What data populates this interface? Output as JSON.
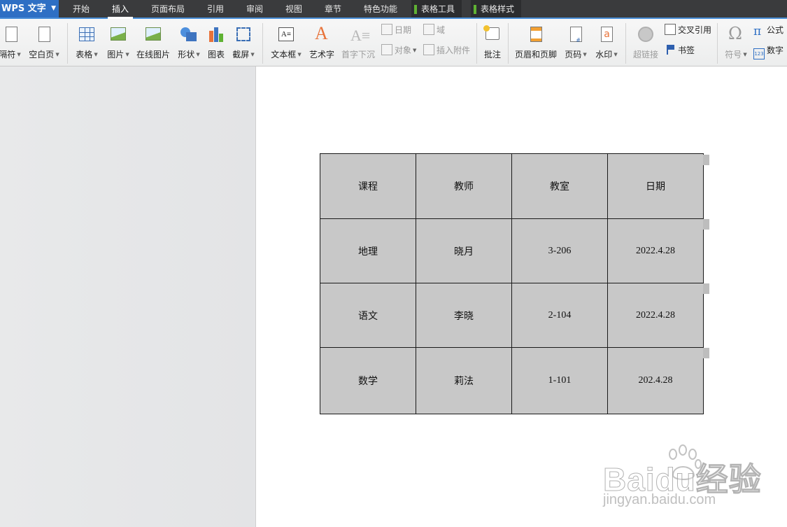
{
  "app": {
    "title": "WPS 文字"
  },
  "menu": {
    "tabs": [
      "开始",
      "插入",
      "页面布局",
      "引用",
      "审阅",
      "视图",
      "章节",
      "特色功能"
    ],
    "active": "插入",
    "context_tabs": [
      "表格工具",
      "表格样式"
    ]
  },
  "ribbon": {
    "break": "隔符",
    "blank_page": "空白页",
    "table": "表格",
    "picture": "图片",
    "online_picture": "在线图片",
    "shapes": "形状",
    "chart": "图表",
    "screenshot": "截屏",
    "text_box": "文本框",
    "word_art": "艺术字",
    "drop_cap": "首字下沉",
    "date": "日期",
    "field": "域",
    "object": "对象",
    "attachment": "插入附件",
    "comment": "批注",
    "header_footer": "页眉和页脚",
    "page_number": "页码",
    "watermark": "水印",
    "hyperlink": "超链接",
    "cross_ref": "交叉引用",
    "bookmark": "书签",
    "symbol": "符号",
    "formula": "公式",
    "number": "数字"
  },
  "table": {
    "rows": [
      [
        "课程",
        "教师",
        "教室",
        "日期"
      ],
      [
        "地理",
        "晓月",
        "3-206",
        "2022.4.28"
      ],
      [
        "语文",
        "李晓",
        "2-104",
        "2022.4.28"
      ],
      [
        "数学",
        "莉法",
        "1-101",
        "202.4.28"
      ]
    ]
  },
  "watermark": {
    "brand": "Baidu经验",
    "url": "jingyan.baidu.com"
  },
  "colors": {
    "menubar": "#3a3b3d",
    "accent": "#2e6fc4",
    "table_fill": "#c8c8c8",
    "context_tab_marker": "#5fb233"
  }
}
